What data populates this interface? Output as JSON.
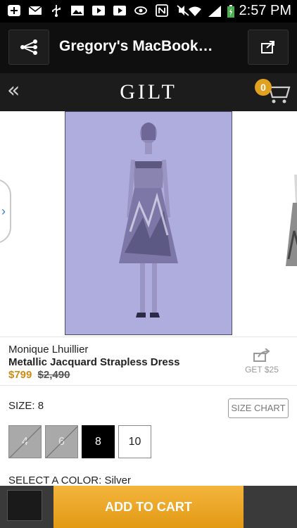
{
  "status_bar": {
    "time": "2:57 PM",
    "icons": [
      "add-icon",
      "mail-icon",
      "usb-icon",
      "image-icon",
      "youtube-icon",
      "play-icon",
      "eye-icon",
      "nfc-icon",
      "mute-icon",
      "wifi-icon",
      "signal-icon",
      "battery-charging-icon"
    ]
  },
  "app_bar": {
    "title": "Gregory's MacBook…",
    "left_icon": "share-network-icon",
    "right_icon": "open-external-icon"
  },
  "gilt_bar": {
    "back_icon": "double-chevron-left-icon",
    "logo": "GILT",
    "cart_count": "0",
    "cart_icon": "cart-icon"
  },
  "product": {
    "brand": "Monique Lhuillier",
    "name": "Metallic Jacquard Strapless Dress",
    "price_sale": "$799",
    "price_original": "$2,490",
    "share_label": "GET $25"
  },
  "size": {
    "label": "SIZE:",
    "selected": "8",
    "chart_label": "SIZE CHART",
    "options": [
      {
        "label": "4",
        "state": "unavailable"
      },
      {
        "label": "6",
        "state": "unavailable"
      },
      {
        "label": "8",
        "state": "selected"
      },
      {
        "label": "10",
        "state": "available"
      }
    ]
  },
  "color": {
    "label": "SELECT A COLOR:",
    "selected": "Silver"
  },
  "bottom_bar": {
    "add_to_cart": "ADD TO CART"
  },
  "colors": {
    "accent": "#e29a14",
    "price": "#d18a12",
    "image_overlay": "#aeadde"
  }
}
